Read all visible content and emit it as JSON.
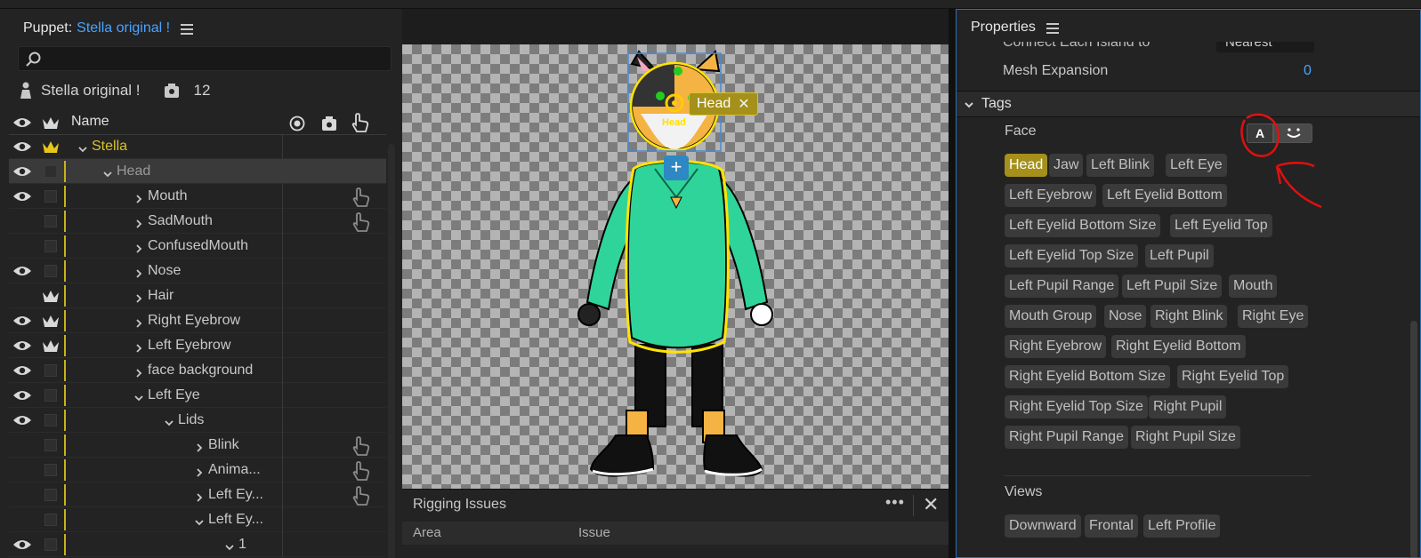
{
  "puppet_panel": {
    "label": "Puppet:",
    "puppet_name": "Stella original !",
    "search_placeholder": "",
    "info_name": "Stella original !",
    "info_count": "12",
    "col_name": "Name",
    "rows": [
      {
        "label": "Stella",
        "depth": 0,
        "expanded": true,
        "eye": true,
        "crown": true,
        "style": "yel"
      },
      {
        "label": "Head",
        "depth": 1,
        "expanded": true,
        "eye": true,
        "crown": false,
        "style": "dim",
        "selected": true
      },
      {
        "label": "Mouth",
        "depth": 2,
        "expanded": false,
        "eye": true,
        "crown": false,
        "hand": true
      },
      {
        "label": "SadMouth",
        "depth": 2,
        "expanded": false,
        "eye": false,
        "crown": false,
        "hand": true
      },
      {
        "label": "ConfusedMouth",
        "depth": 2,
        "expanded": false,
        "eye": false,
        "crown": false
      },
      {
        "label": "Nose",
        "depth": 2,
        "expanded": false,
        "eye": true,
        "crown": false
      },
      {
        "label": "Hair",
        "depth": 2,
        "expanded": false,
        "eye": false,
        "crown": true
      },
      {
        "label": "Right Eyebrow",
        "depth": 2,
        "expanded": false,
        "eye": true,
        "crown": true
      },
      {
        "label": "Left Eyebrow",
        "depth": 2,
        "expanded": false,
        "eye": true,
        "crown": true
      },
      {
        "label": "face background",
        "depth": 2,
        "expanded": false,
        "eye": true,
        "crown": false
      },
      {
        "label": "Left Eye",
        "depth": 2,
        "expanded": true,
        "eye": true,
        "crown": false
      },
      {
        "label": "Lids",
        "depth": 3,
        "expanded": true,
        "eye": true,
        "crown": false
      },
      {
        "label": "Blink",
        "depth": 4,
        "expanded": false,
        "eye": false,
        "crown": false,
        "hand": true
      },
      {
        "label": "Anima...",
        "depth": 4,
        "expanded": false,
        "eye": false,
        "crown": false,
        "hand": true
      },
      {
        "label": "Left Ey...",
        "depth": 4,
        "expanded": false,
        "eye": false,
        "crown": false,
        "hand": true
      },
      {
        "label": "Left Ey...",
        "depth": 4,
        "expanded": true,
        "eye": false,
        "crown": false
      },
      {
        "label": "1",
        "depth": 5,
        "expanded": true,
        "eye": true,
        "crown": false
      }
    ]
  },
  "stage": {
    "head_tag": "Head",
    "head_tag_close": "✕",
    "handle_label": "Head",
    "add_button": "+"
  },
  "rigging": {
    "title": "Rigging Issues",
    "more": "•••",
    "close": "✕",
    "col_area": "Area",
    "col_issue": "Issue"
  },
  "properties": {
    "title": "Properties",
    "cut_label": "Connect Each Island to",
    "cut_value": "Nearest",
    "mesh_label": "Mesh Expansion",
    "mesh_value": "0",
    "tags_section": "Tags",
    "face_label": "Face",
    "face_btn_a": "A",
    "tags": [
      "Head",
      "Jaw",
      "Left Blink",
      "Left Eye",
      "Left Eyebrow",
      "Left Eyelid Bottom",
      "Left Eyelid Bottom Size",
      "Left Eyelid Top",
      "Left Eyelid Top Size",
      "Left Pupil",
      "Left Pupil Range",
      "Left Pupil Size",
      "Mouth",
      "Mouth Group",
      "Nose",
      "Right Blink",
      "Right Eye",
      "Right Eyebrow",
      "Right Eyelid Bottom",
      "Right Eyelid Bottom Size",
      "Right Eyelid Top",
      "Right Eyelid Top Size",
      "Right Pupil",
      "Right Pupil Range",
      "Right Pupil Size"
    ],
    "active_tag": "Head",
    "views_label": "Views",
    "views": [
      "Downward",
      "Frontal",
      "Left Profile"
    ]
  },
  "colors": {
    "accent_blue": "#4aa3ff",
    "tag_active": "#a4901a",
    "annotation_red": "#e01010"
  }
}
